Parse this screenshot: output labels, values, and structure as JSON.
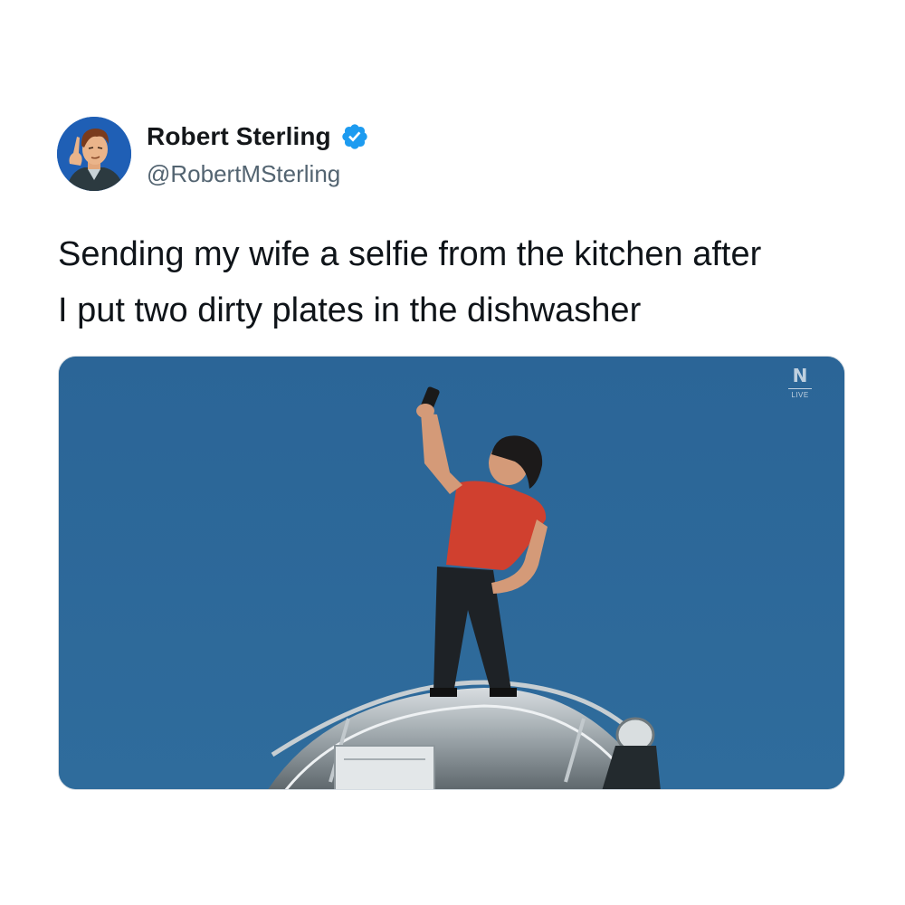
{
  "author": {
    "display_name": "Robert Sterling",
    "handle": "@RobertMSterling",
    "avatar_icon": "cartoon-man-avatar",
    "verified_icon": "verified-badge-icon",
    "verified_color": "#1d9bf0"
  },
  "tweet": {
    "text": "Sending my wife a selfie from the kitchen after\nI put two dirty plates in the dishwasher"
  },
  "media": {
    "description_icon": "man-on-rooftop-selfie-image",
    "watermark": {
      "logo": "N",
      "label": "LIVE"
    },
    "sky_color": "#2e6a9a"
  }
}
